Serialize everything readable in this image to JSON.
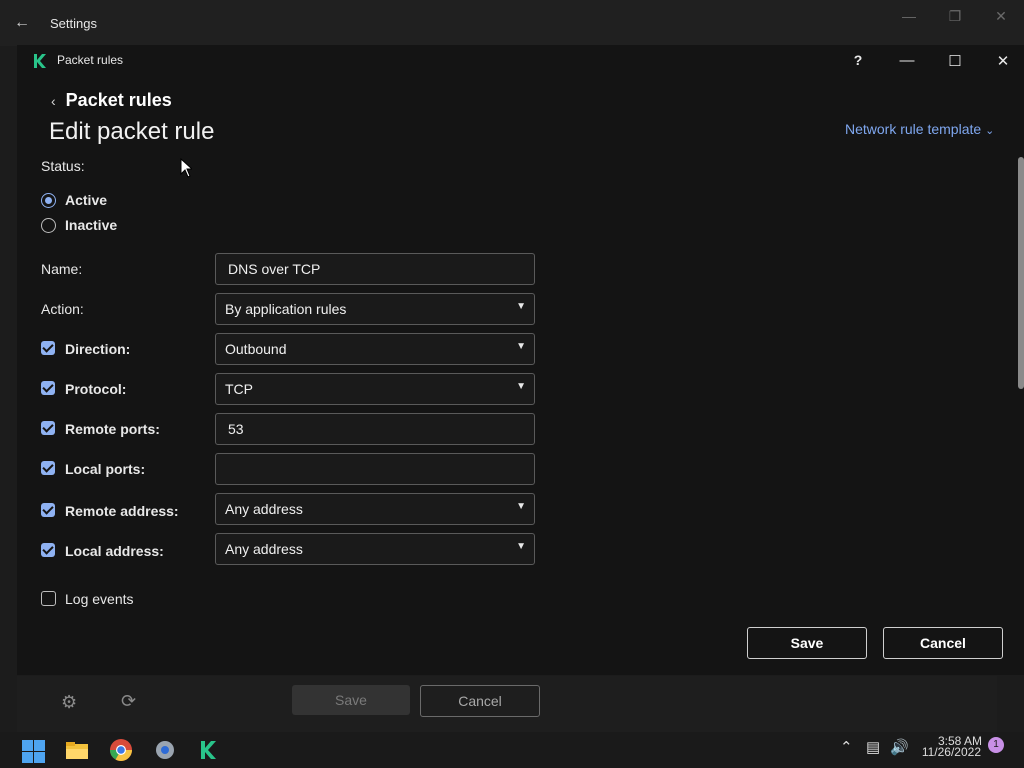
{
  "outer_window": {
    "title": "Settings",
    "back_icon": "arrow-left-icon"
  },
  "app_window": {
    "title": "Packet rules",
    "help_label": "?"
  },
  "breadcrumb": {
    "label": "Packet rules"
  },
  "page_title": "Edit packet rule",
  "template_link": {
    "label": "Network rule template"
  },
  "status": {
    "label": "Status:",
    "options": [
      {
        "label": "Active",
        "selected": true
      },
      {
        "label": "Inactive",
        "selected": false
      }
    ]
  },
  "form": {
    "name": {
      "label": "Name:",
      "value": "DNS over TCP"
    },
    "action": {
      "label": "Action:",
      "value": "By application rules"
    },
    "direction": {
      "label": "Direction:",
      "checked": true,
      "value": "Outbound"
    },
    "protocol": {
      "label": "Protocol:",
      "checked": true,
      "value": "TCP"
    },
    "remote_ports": {
      "label": "Remote ports:",
      "checked": true,
      "value": "53"
    },
    "local_ports": {
      "label": "Local ports:",
      "checked": true,
      "value": ""
    },
    "remote_address": {
      "label": "Remote address:",
      "checked": true,
      "value": "Any address"
    },
    "local_address": {
      "label": "Local address:",
      "checked": true,
      "value": "Any address"
    },
    "log_events": {
      "label": "Log events",
      "checked": false
    }
  },
  "buttons": {
    "save": "Save",
    "cancel": "Cancel"
  },
  "bottom_bar": {
    "save": "Save",
    "cancel": "Cancel"
  },
  "taskbar": {
    "time": "3:58 AM",
    "date": "11/26/2022",
    "notification_count": "1"
  },
  "colors": {
    "accent": "#8fb2f2",
    "link": "#7fa7ef",
    "background": "#141414"
  }
}
